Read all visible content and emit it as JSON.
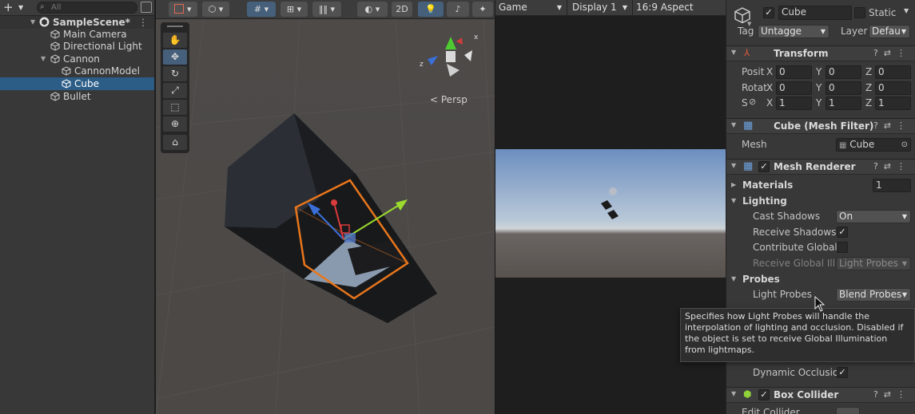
{
  "hierarchy": {
    "add_label": "+",
    "search_placeholder": "All",
    "scene_name": "SampleScene*",
    "items": [
      {
        "label": "Main Camera"
      },
      {
        "label": "Directional Light"
      },
      {
        "label": "Cannon"
      },
      {
        "label": "CannonModel"
      },
      {
        "label": "Cube"
      },
      {
        "label": "Bullet"
      }
    ]
  },
  "scene_view": {
    "toolbar": {
      "mode_2d": "2D"
    },
    "persp_label": "Persp"
  },
  "game_view": {
    "tab_label": "Game",
    "display": "Display 1",
    "aspect": "16:9 Aspect"
  },
  "inspector": {
    "object_name": "Cube",
    "static_label": "Static",
    "tag_label": "Tag",
    "tag_value": "Untagge",
    "layer_label": "Layer",
    "layer_value": "Defau",
    "transform": {
      "title": "Transform",
      "position_label": "Posit",
      "rotation_label": "Rotat",
      "scale_label": "S",
      "axis_x": "X",
      "axis_y": "Y",
      "axis_z": "Z",
      "position": [
        "0",
        "0",
        "0"
      ],
      "rotation": [
        "0",
        "0",
        "0"
      ],
      "scale": [
        "1",
        "1",
        "1"
      ]
    },
    "mesh_filter": {
      "title": "Cube (Mesh Filter)",
      "mesh_label": "Mesh",
      "mesh_value": "Cube"
    },
    "mesh_renderer": {
      "title": "Mesh Renderer",
      "materials_label": "Materials",
      "materials_count": "1",
      "lighting_label": "Lighting",
      "cast_shadows_label": "Cast Shadows",
      "cast_shadows_value": "On",
      "receive_shadows_label": "Receive Shadows",
      "contribute_gi_label": "Contribute Global I",
      "receive_gi_label": "Receive Global Illu",
      "receive_gi_value": "Light Probes",
      "probes_label": "Probes",
      "light_probes_label": "Light Probes",
      "light_probes_value": "Blend Probes",
      "dynamic_occlusion_label": "Dynamic Occlusio"
    },
    "box_collider": {
      "title": "Box Collider",
      "edit_collider_label": "Edit Collider"
    }
  },
  "tooltip": {
    "text": "Specifies how Light Probes will handle the interpolation of lighting and occlusion. Disabled if the object is set to receive Global Illumination from lightmaps."
  }
}
